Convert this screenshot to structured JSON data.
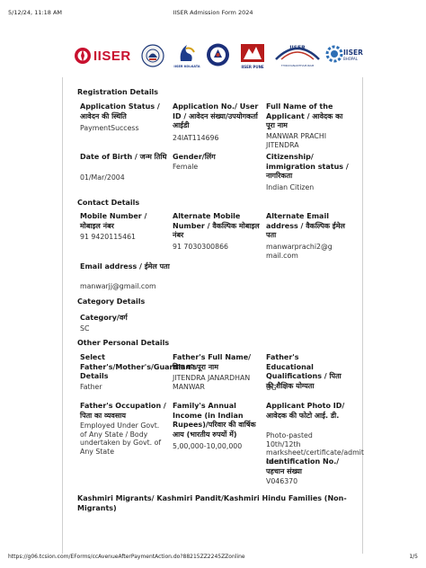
{
  "print_header": {
    "timestamp": "5/12/24, 11:18 AM",
    "title": "IISER Admission Form 2024"
  },
  "print_footer": {
    "url": "https://g06.tcsion.com/EForms/ccAvenueAfterPaymentAction.do?88215ZZ2245ZZonline",
    "page": "1/5"
  },
  "logos": {
    "iiser_text": "IISER",
    "kolkata": "IISER KOLKATA",
    "pune": "IISER PUNE",
    "tvm_main": "IISER",
    "tvm_sub": "THIRUVANANTHAPURAM",
    "bhopal_main": "IISER",
    "bhopal_sub": "BHOPAL"
  },
  "sections": {
    "registration": "Registration Details",
    "contact": "Contact Details",
    "category": "Category Details",
    "other": "Other Personal Details"
  },
  "fields": {
    "app_status": {
      "label": "Application Status / आवेदन की स्थिति",
      "value": "PaymentSuccess"
    },
    "app_no": {
      "label": "Application No./ User ID / आवेदन संख्या/उपयोगकर्ता आईडी",
      "value": "24IAT114696"
    },
    "full_name": {
      "label": "Full Name of the Applicant / आवेदक का पूरा नाम",
      "value": "MANWAR PRACHI JITENDRA"
    },
    "dob": {
      "label": "Date of Birth / जन्म तिथि",
      "value": "01/Mar/2004"
    },
    "gender": {
      "label": "Gender/लिंग",
      "value": "Female"
    },
    "citizenship": {
      "label": "Citizenship/ immigration status / नागरिकता",
      "value": "Indian Citizen"
    },
    "mobile": {
      "label": "Mobile Number / मोबाइल नंबर",
      "value": "91 9420115461"
    },
    "alt_mobile": {
      "label": "Alternate Mobile Number / वैकल्पिक मोबाइल नंबर",
      "value": "91 7030300866"
    },
    "alt_email": {
      "label": "Alternate Email address / वैकल्पिक ईमेल पता",
      "value": "manwarprachi2@gmail.com"
    },
    "email": {
      "label": "Email address / ईमेल पता",
      "value": "manwarjj@gmail.com"
    },
    "category": {
      "label": "Category/वर्ग",
      "value": "SC"
    },
    "select_parent": {
      "label": "Select Father's/Mother's/Guardian's Details",
      "value": "Father"
    },
    "father_name": {
      "label": "Father's Full Name/ पिता का पूरा नाम",
      "value": "JITENDRA JANARDHAN MANWAR"
    },
    "father_edu": {
      "label": "Father's Educational Qualifications / पिता की शैक्षिक योग्यता",
      "value": "UG"
    },
    "father_occ": {
      "label": "Father's Occupation / पिता का व्यवसाय",
      "value": "Employed Under Govt. of Any State / Body undertaken by Govt. of Any State"
    },
    "family_income": {
      "label": "Family's Annual Income (in Indian Rupees)/परिवार की वार्षिक आय (भारतीय रुपयों में)",
      "value": "5,00,000-10,00,000"
    },
    "photo_id": {
      "label": "Applicant Photo ID/ आवेदक की फोटो आई. डी.",
      "value": "Photo-pasted 10th/12th marksheet/certificate/admit card"
    },
    "id_no": {
      "label": "Identification No./पहचान संख्या",
      "value": "V046370"
    },
    "kashmiri": {
      "label": "Kashmiri Migrants/ Kashmiri Pandit/Kashmiri Hindu Families (Non-Migrants)"
    }
  }
}
